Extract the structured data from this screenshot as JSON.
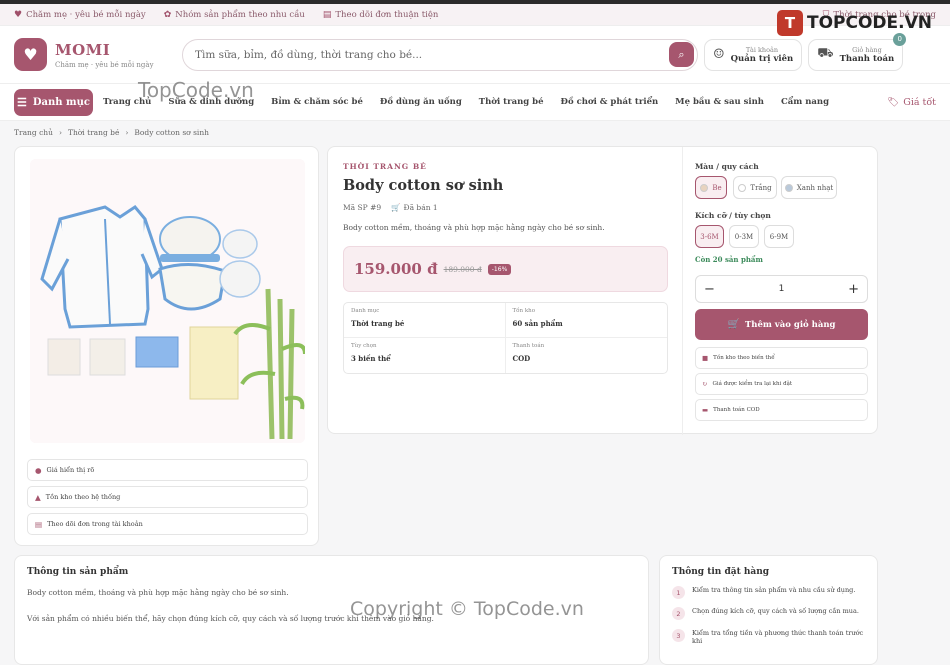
{
  "topbar": {
    "items": [
      {
        "icon": "heart-icon",
        "label": "Chăm mẹ · yêu bé mỗi ngày"
      },
      {
        "icon": "baby-icon",
        "label": "Nhóm sản phẩm theo nhu cầu"
      },
      {
        "icon": "receipt-icon",
        "label": "Theo dõi đơn thuận tiện"
      }
    ],
    "right_label": "Thời trang cho bé trong"
  },
  "watermark_logo": "TOPCODE.VN",
  "header": {
    "brand": "MOMI",
    "tagline": "Chăm mẹ · yêu bé mỗi ngày",
    "search_placeholder": "Tìm sữa, bỉm, đồ dùng, thời trang cho bé...",
    "account_small": "Tài khoản",
    "account_big": "Quản trị viên",
    "cart_small": "Giỏ hàng",
    "cart_big": "Thanh toán",
    "cart_count": "0"
  },
  "nav": {
    "category_button": "Danh mục",
    "items": [
      "Trang chủ",
      "Sữa & dinh dưỡng",
      "Bỉm & chăm sóc bé",
      "Đồ dùng ăn uống",
      "Thời trang bé",
      "Đồ chơi & phát triển",
      "Mẹ bầu & sau sinh",
      "Cẩm nang"
    ],
    "good_price": "Giá tốt"
  },
  "breadcrumb": [
    "Trang chủ",
    "Thời trang bé",
    "Body cotton sơ sinh"
  ],
  "gallery_features": [
    "Giá hiển thị rõ",
    "Tồn kho theo hệ thống",
    "Theo dõi đơn trong tài khoản"
  ],
  "product": {
    "category": "THỜI TRANG BÉ",
    "name": "Body cotton sơ sinh",
    "sku": "Mã SP #9",
    "sold": "Đã bán 1",
    "description": "Body cotton mềm, thoáng và phù hợp mặc hằng ngày cho bé sơ sinh.",
    "price": "159.000 đ",
    "old_price": "189.000 đ",
    "discount": "-16%",
    "specs": [
      {
        "label": "Danh mục",
        "value": "Thời trang bé"
      },
      {
        "label": "Tồn kho",
        "value": "60 sản phẩm"
      },
      {
        "label": "Tùy chọn",
        "value": "3 biến thể"
      },
      {
        "label": "Thanh toán",
        "value": "COD"
      }
    ]
  },
  "options": {
    "color_label": "Màu / quy cách",
    "colors": [
      {
        "name": "Be",
        "swatch": "#e8d3bf"
      },
      {
        "name": "Trắng",
        "swatch": "#ffffff"
      },
      {
        "name": "Xanh nhạt",
        "swatch": "#b9c9da"
      }
    ],
    "size_label": "Kích cỡ / tùy chọn",
    "sizes": [
      "3-6M",
      "0-3M",
      "6-9M"
    ],
    "stock_text": "Còn 20 sản phẩm",
    "quantity": "1",
    "add_to_cart": "Thêm vào giỏ hàng",
    "features": [
      "Tồn kho theo biến thể",
      "Giá được kiểm tra lại khi đặt",
      "Thanh toán COD"
    ]
  },
  "product_info": {
    "title": "Thông tin sản phẩm",
    "p1": "Body cotton mềm, thoáng và phù hợp mặc hằng ngày cho bé sơ sinh.",
    "p2": "Với sản phẩm có nhiều biến thể, hãy chọn đúng kích cỡ, quy cách và số lượng trước khi thêm vào giỏ hàng."
  },
  "order_info": {
    "title": "Thông tin đặt hàng",
    "steps": [
      "Kiểm tra thông tin sản phẩm và nhu cầu sử dụng.",
      "Chọn đúng kích cỡ, quy cách và số lượng cần mua.",
      "Kiểm tra tổng tiền và phương thức thanh toán trước khi"
    ]
  },
  "watermarks": [
    "TopCode.vn",
    "Copyright © TopCode.vn"
  ],
  "colors": {
    "accent": "#a6566e",
    "accent_light": "#f9eef1",
    "success": "#3b8a5a"
  }
}
